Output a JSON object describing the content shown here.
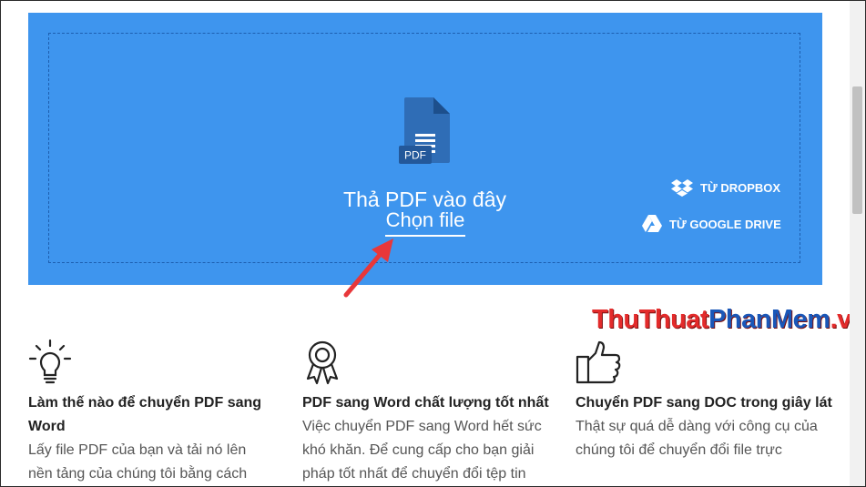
{
  "upload": {
    "drop_title": "Thả PDF vào đây",
    "choose_file": "Chọn file",
    "file_badge": "PDF",
    "dropbox": "TỪ DROPBOX",
    "gdrive": "TỪ GOOGLE DRIVE",
    "panel_color": "#3e95ee"
  },
  "watermark": {
    "part1": "ThuThuat",
    "part2": "PhanMem",
    "part3": ".vn"
  },
  "features": [
    {
      "icon": "lightbulb-icon",
      "title": "Làm thế nào để chuyển PDF sang Word",
      "text": "Lấy file PDF của bạn và tải nó lên nền tảng của chúng tôi bằng cách"
    },
    {
      "icon": "award-ribbon-icon",
      "title": "PDF sang Word chất lượng tốt nhất",
      "text": "Việc chuyển PDF sang Word hết sức khó khăn. Để cung cấp cho bạn giải pháp tốt nhất để chuyển đổi tệp tin"
    },
    {
      "icon": "thumbs-up-icon",
      "title": "Chuyển PDF sang DOC trong giây lát",
      "text": "Thật sự quá dễ dàng với công cụ của chúng tôi để chuyển đổi file trực"
    }
  ]
}
